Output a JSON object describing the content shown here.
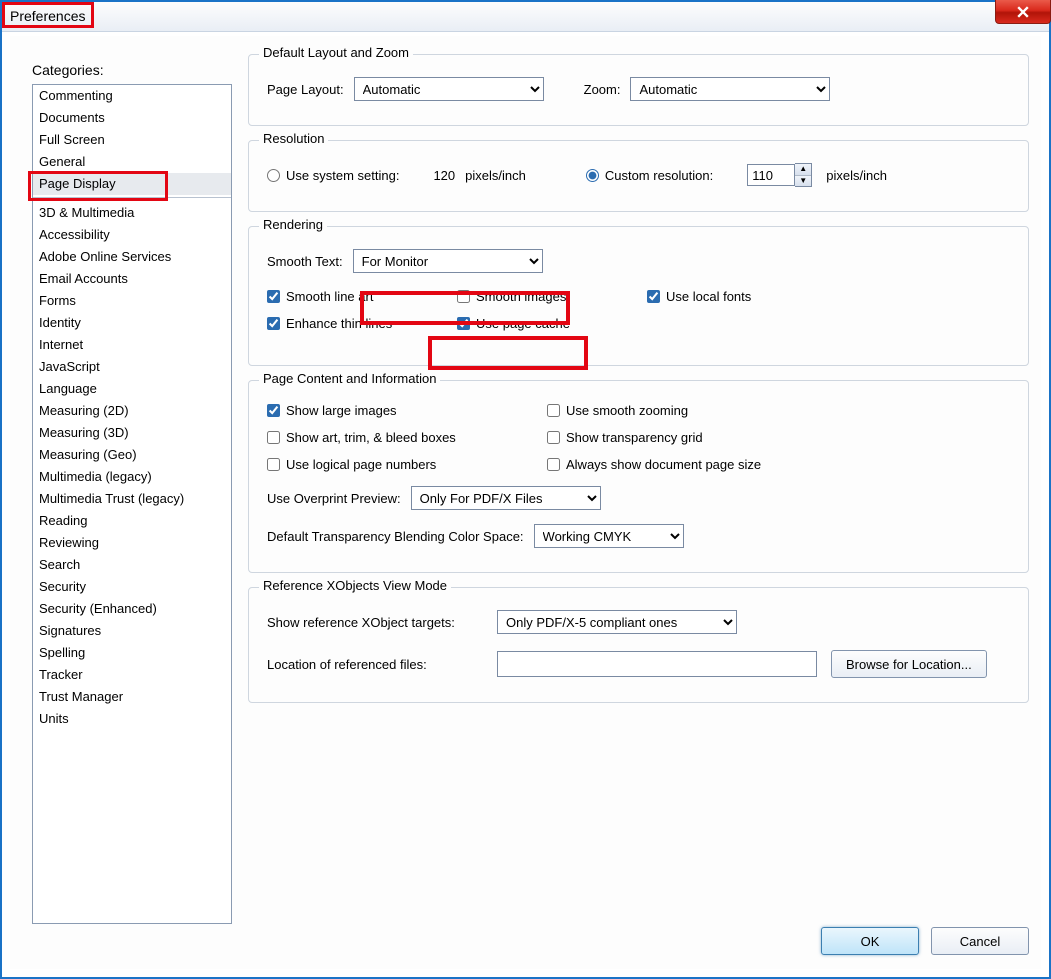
{
  "window": {
    "title": "Preferences"
  },
  "categories_label": "Categories:",
  "categories_top": [
    "Commenting",
    "Documents",
    "Full Screen",
    "General",
    "Page Display"
  ],
  "categories_selected": "Page Display",
  "categories_rest": [
    "3D & Multimedia",
    "Accessibility",
    "Adobe Online Services",
    "Email Accounts",
    "Forms",
    "Identity",
    "Internet",
    "JavaScript",
    "Language",
    "Measuring (2D)",
    "Measuring (3D)",
    "Measuring (Geo)",
    "Multimedia (legacy)",
    "Multimedia Trust (legacy)",
    "Reading",
    "Reviewing",
    "Search",
    "Security",
    "Security (Enhanced)",
    "Signatures",
    "Spelling",
    "Tracker",
    "Trust Manager",
    "Units"
  ],
  "layout_zoom": {
    "title": "Default Layout and Zoom",
    "page_layout_label": "Page Layout:",
    "page_layout_value": "Automatic",
    "zoom_label": "Zoom:",
    "zoom_value": "Automatic"
  },
  "resolution": {
    "title": "Resolution",
    "use_system_label": "Use system setting:",
    "system_value": "120",
    "system_unit": "pixels/inch",
    "custom_label": "Custom resolution:",
    "custom_value": "110",
    "custom_unit": "pixels/inch",
    "selected": "custom"
  },
  "rendering": {
    "title": "Rendering",
    "smooth_text_label": "Smooth Text:",
    "smooth_text_value": "For Monitor",
    "smooth_line_art": {
      "label": "Smooth line art",
      "checked": true
    },
    "smooth_images": {
      "label": "Smooth images",
      "checked": false
    },
    "use_local_fonts": {
      "label": "Use local fonts",
      "checked": true
    },
    "enhance_thin_lines": {
      "label": "Enhance thin lines",
      "checked": true
    },
    "use_page_cache": {
      "label": "Use page cache",
      "checked": true
    }
  },
  "page_content": {
    "title": "Page Content and Information",
    "show_large_images": {
      "label": "Show large images",
      "checked": true
    },
    "use_smooth_zooming": {
      "label": "Use smooth zooming",
      "checked": false
    },
    "show_art_trim_bleed": {
      "label": "Show art, trim, & bleed boxes",
      "checked": false
    },
    "show_transparency_grid": {
      "label": "Show transparency grid",
      "checked": false
    },
    "use_logical_page_numbers": {
      "label": "Use logical page numbers",
      "checked": false
    },
    "always_show_doc_page_size": {
      "label": "Always show document page size",
      "checked": false
    },
    "overprint_label": "Use Overprint Preview:",
    "overprint_value": "Only For PDF/X Files",
    "blend_label": "Default Transparency Blending Color Space:",
    "blend_value": "Working CMYK"
  },
  "xobjects": {
    "title": "Reference XObjects View Mode",
    "show_ref_label": "Show reference XObject targets:",
    "show_ref_value": "Only PDF/X-5 compliant ones",
    "location_label": "Location of referenced files:",
    "location_value": "",
    "browse_label": "Browse for Location..."
  },
  "footer": {
    "ok": "OK",
    "cancel": "Cancel"
  }
}
